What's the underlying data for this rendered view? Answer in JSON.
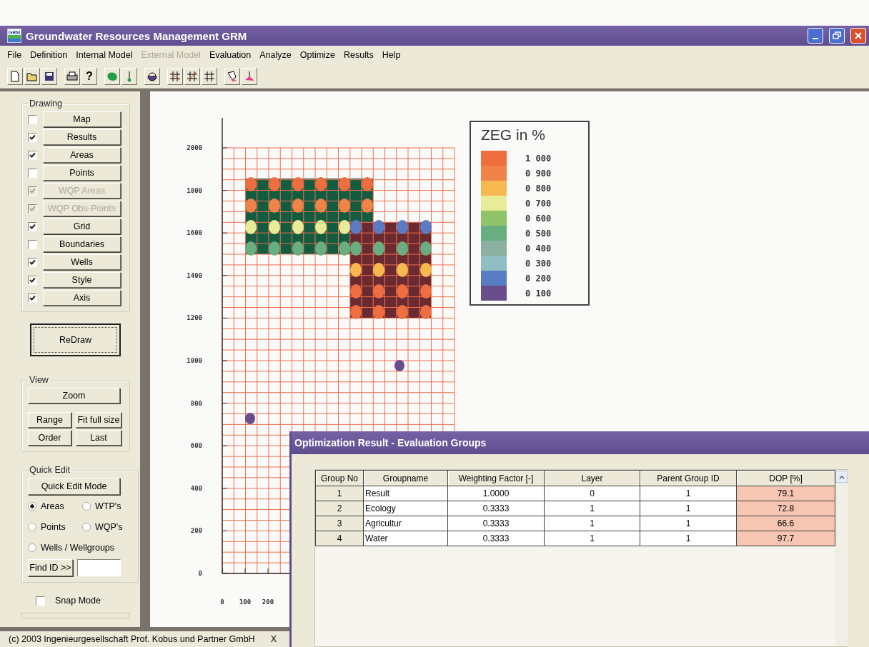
{
  "window": {
    "title": "Groundwater Resources Management GRM",
    "icon_label": "GRM"
  },
  "menu": [
    {
      "label": "File",
      "disabled": false
    },
    {
      "label": "Definition",
      "disabled": false
    },
    {
      "label": "Internal Model",
      "disabled": false
    },
    {
      "label": "External Model",
      "disabled": true
    },
    {
      "label": "Evaluation",
      "disabled": false
    },
    {
      "label": "Analyze",
      "disabled": false
    },
    {
      "label": "Optimize",
      "disabled": false
    },
    {
      "label": "Results",
      "disabled": false
    },
    {
      "label": "Help",
      "disabled": false
    }
  ],
  "toolbar": {
    "help_label": "?"
  },
  "drawing_panel": {
    "title": "Drawing",
    "items": [
      {
        "label": "Map",
        "checked": false,
        "disabled": false
      },
      {
        "label": "Results",
        "checked": true,
        "disabled": false
      },
      {
        "label": "Areas",
        "checked": true,
        "disabled": false
      },
      {
        "label": "Points",
        "checked": false,
        "disabled": false
      },
      {
        "label": "WQP Areas",
        "checked": true,
        "disabled": true
      },
      {
        "label": "WQP Obs-Points",
        "checked": true,
        "disabled": true
      },
      {
        "label": "Grid",
        "checked": true,
        "disabled": false
      },
      {
        "label": "Boundaries",
        "checked": false,
        "disabled": false
      },
      {
        "label": "Wells",
        "checked": true,
        "disabled": false
      },
      {
        "label": "Style",
        "checked": true,
        "disabled": false
      },
      {
        "label": "Axis",
        "checked": true,
        "disabled": false
      }
    ]
  },
  "redraw_button": "ReDraw",
  "view_panel": {
    "title": "View",
    "zoom": "Zoom",
    "buttons": [
      "Range",
      "Fit full size",
      "Order",
      "Last"
    ]
  },
  "quick_edit": {
    "title": "Quick Edit",
    "mode_button": "Quick Edit Mode",
    "options": [
      {
        "label": "Areas",
        "selected": true
      },
      {
        "label": "WTP's",
        "selected": false
      },
      {
        "label": "Points",
        "selected": false
      },
      {
        "label": "WQP's",
        "selected": false
      },
      {
        "label": "Wells / Wellgroups",
        "selected": false
      }
    ],
    "find_button": "Find ID >>"
  },
  "snap_mode": {
    "label": "Snap Mode",
    "checked": false
  },
  "plot": {
    "y_ticks": [
      "2000",
      "1800",
      "1600",
      "1400",
      "1200",
      "1000",
      "800",
      "600",
      "400",
      "200",
      "0"
    ],
    "x_ticks": [
      "0",
      "100",
      "200"
    ]
  },
  "legend": {
    "title": "ZEG in %",
    "items": [
      {
        "label": "1 000",
        "color": "#ee6e40"
      },
      {
        "label": "0 900",
        "color": "#f08448"
      },
      {
        "label": "0 800",
        "color": "#f8b850"
      },
      {
        "label": "0 700",
        "color": "#e8ec98"
      },
      {
        "label": "0 600",
        "color": "#90c468"
      },
      {
        "label": "0 500",
        "color": "#68ae80"
      },
      {
        "label": "0 400",
        "color": "#8cb0a0"
      },
      {
        "label": "0 300",
        "color": "#90bcc4"
      },
      {
        "label": "0 200",
        "color": "#5a7cc4"
      },
      {
        "label": "0 100",
        "color": "#6a4e8c"
      }
    ]
  },
  "status_bar": {
    "copyright": "(c) 2003 Ingenieurgesellschaft Prof. Kobus und Partner GmbH",
    "mark": "X"
  },
  "dialog": {
    "title": "Optimization Result - Evaluation Groups",
    "columns": [
      "Group No",
      "Groupname",
      "Weighting Factor [-]",
      "Layer",
      "Parent Group ID",
      "DOP [%]"
    ],
    "rows": [
      [
        "1",
        "Result",
        "1.0000",
        "0",
        "1",
        "79.1"
      ],
      [
        "2",
        "Ecology",
        "0.3333",
        "1",
        "1",
        "72.8"
      ],
      [
        "3",
        "Agricultur",
        "0.3333",
        "1",
        "1",
        "66.6"
      ],
      [
        "4",
        "Water",
        "0.3333",
        "1",
        "1",
        "97.7"
      ]
    ]
  }
}
